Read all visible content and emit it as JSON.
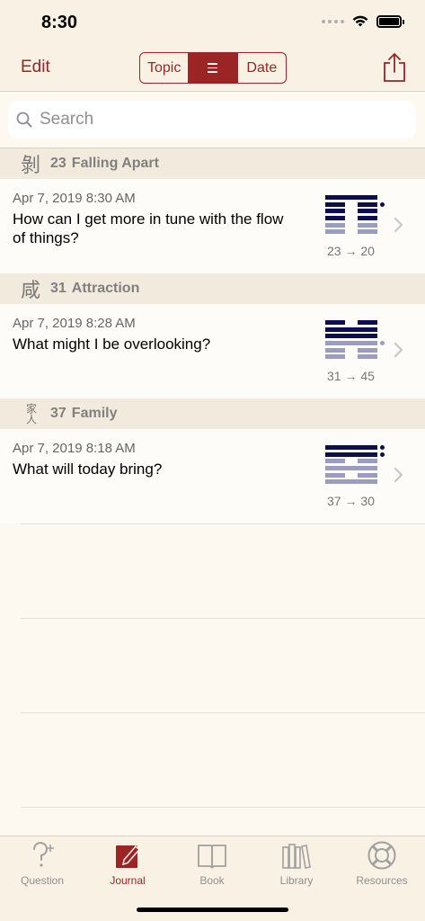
{
  "status_bar": {
    "time": "8:30"
  },
  "nav": {
    "edit_label": "Edit",
    "segments": [
      {
        "label": "Topic",
        "active": false
      },
      {
        "label": "",
        "icon": "list-icon",
        "active": true
      },
      {
        "label": "Date",
        "active": false
      }
    ],
    "share_icon": "share-icon"
  },
  "search": {
    "placeholder": "Search",
    "value": ""
  },
  "sections": [
    {
      "glyph": "剝",
      "number": "23",
      "title": "Falling Apart",
      "entries": [
        {
          "date": "Apr 7, 2019 8:30 AM",
          "question": "How can I get more in tune with the flow of things?",
          "transition": "23 → 20",
          "hexagram_lines_top_to_bottom": [
            "yang",
            "yin",
            "yin",
            "yin",
            "yin",
            "yin"
          ],
          "changing_lines_top_to_bottom": [
            false,
            true,
            false,
            false,
            false,
            false
          ],
          "colors": [
            "#0b0f4f",
            "#0b0f4f",
            "#0b0f4f",
            "#0b0f4f",
            "#9a9dbf",
            "#9a9dbf"
          ]
        }
      ]
    },
    {
      "glyph": "咸",
      "number": "31",
      "title": "Attraction",
      "entries": [
        {
          "date": "Apr 7, 2019 8:28 AM",
          "question": "What might I be overlooking?",
          "transition": "31 → 45",
          "hexagram_lines_top_to_bottom": [
            "yin",
            "yang",
            "yang",
            "yang",
            "yin",
            "yin"
          ],
          "changing_lines_top_to_bottom": [
            false,
            false,
            false,
            true,
            false,
            false
          ],
          "colors": [
            "#0b0f4f",
            "#0b0f4f",
            "#0b0f4f",
            "#9a9dbf",
            "#9a9dbf",
            "#9a9dbf"
          ]
        }
      ]
    },
    {
      "glyph": "家人",
      "number": "37",
      "title": "Family",
      "entries": [
        {
          "date": "Apr 7, 2019 8:18 AM",
          "question": "What will today bring?",
          "transition": "37 → 30",
          "hexagram_lines_top_to_bottom": [
            "yang",
            "yang",
            "yin",
            "yang",
            "yin",
            "yang"
          ],
          "changing_lines_top_to_bottom": [
            true,
            true,
            false,
            false,
            false,
            false
          ],
          "colors": [
            "#0b0f4f",
            "#0b0f4f",
            "#9a9dbf",
            "#9a9dbf",
            "#9a9dbf",
            "#9a9dbf"
          ]
        }
      ]
    }
  ],
  "tabs": [
    {
      "label": "Question",
      "icon": "question-icon",
      "active": false
    },
    {
      "label": "Journal",
      "icon": "journal-icon",
      "active": true
    },
    {
      "label": "Book",
      "icon": "book-icon",
      "active": false
    },
    {
      "label": "Library",
      "icon": "library-icon",
      "active": false
    },
    {
      "label": "Resources",
      "icon": "lifebuoy-icon",
      "active": false
    }
  ],
  "colors": {
    "accent": "#9b2424",
    "hexagram_primary": "#0b0f4f",
    "hexagram_secondary": "#9a9dbf"
  }
}
